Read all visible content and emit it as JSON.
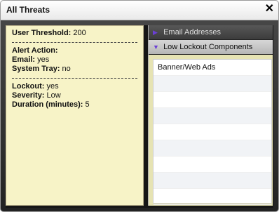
{
  "window": {
    "title": "All Threats",
    "close_label": "✕"
  },
  "summary": {
    "user_threshold_label": "User Threshold:",
    "user_threshold_value": "200",
    "alert_action_label": "Alert Action:",
    "email_label": "Email:",
    "email_value": "yes",
    "system_tray_label": "System Tray:",
    "system_tray_value": "no",
    "lockout_label": "Lockout:",
    "lockout_value": "yes",
    "severity_label": "Severity:",
    "severity_value": "Low",
    "duration_label": "Duration (minutes):",
    "duration_value": "5"
  },
  "panels": [
    {
      "label": "Email Addresses",
      "icon": "triangle-right-icon",
      "expanded": false
    },
    {
      "label": "Low Lockout Components",
      "icon": "triangle-down-icon",
      "expanded": true
    }
  ],
  "components": [
    "Banner/Web Ads",
    "",
    "",
    "",
    "",
    "",
    "",
    "",
    ""
  ],
  "colors": {
    "summary_background": "#f7f3c7",
    "header_background": "#4a4a4a",
    "selected_header_background": "#c4c4c4",
    "triangle_color": "#6b3fd6"
  }
}
